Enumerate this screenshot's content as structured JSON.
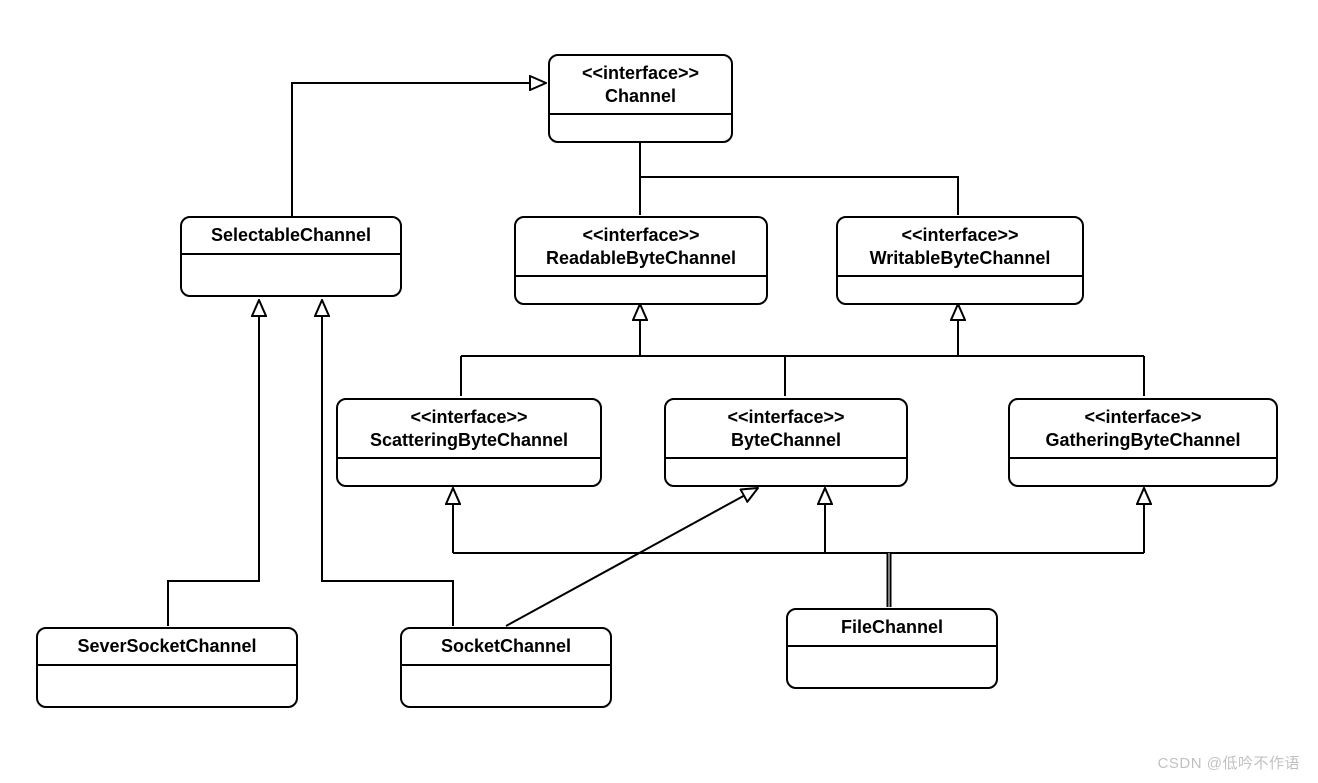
{
  "stereotype": "<<interface>>",
  "nodes": {
    "channel": {
      "name": "Channel",
      "is_interface": true
    },
    "selectableChannel": {
      "name": "SelectableChannel",
      "is_interface": false
    },
    "readableByteChannel": {
      "name": "ReadableByteChannel",
      "is_interface": true
    },
    "writableByteChannel": {
      "name": "WritableByteChannel",
      "is_interface": true
    },
    "scatteringByteChannel": {
      "name": "ScatteringByteChannel",
      "is_interface": true
    },
    "byteChannel": {
      "name": "ByteChannel",
      "is_interface": true
    },
    "gatheringByteChannel": {
      "name": "GatheringByteChannel",
      "is_interface": true
    },
    "severSocketChannel": {
      "name": "SeverSocketChannel",
      "is_interface": false
    },
    "socketChannel": {
      "name": "SocketChannel",
      "is_interface": false
    },
    "fileChannel": {
      "name": "FileChannel",
      "is_interface": false
    }
  },
  "edges": [
    {
      "from": "selectableChannel",
      "to": "channel"
    },
    {
      "from": "readableByteChannel",
      "to": "channel"
    },
    {
      "from": "writableByteChannel",
      "to": "channel"
    },
    {
      "from": "scatteringByteChannel",
      "to": "readableByteChannel"
    },
    {
      "from": "byteChannel",
      "to": "readableByteChannel"
    },
    {
      "from": "byteChannel",
      "to": "writableByteChannel"
    },
    {
      "from": "gatheringByteChannel",
      "to": "writableByteChannel"
    },
    {
      "from": "severSocketChannel",
      "to": "selectableChannel"
    },
    {
      "from": "socketChannel",
      "to": "selectableChannel"
    },
    {
      "from": "socketChannel",
      "to": "byteChannel"
    },
    {
      "from": "fileChannel",
      "to": "scatteringByteChannel"
    },
    {
      "from": "fileChannel",
      "to": "byteChannel"
    },
    {
      "from": "fileChannel",
      "to": "gatheringByteChannel"
    }
  ],
  "watermark": "CSDN @低吟不作语"
}
